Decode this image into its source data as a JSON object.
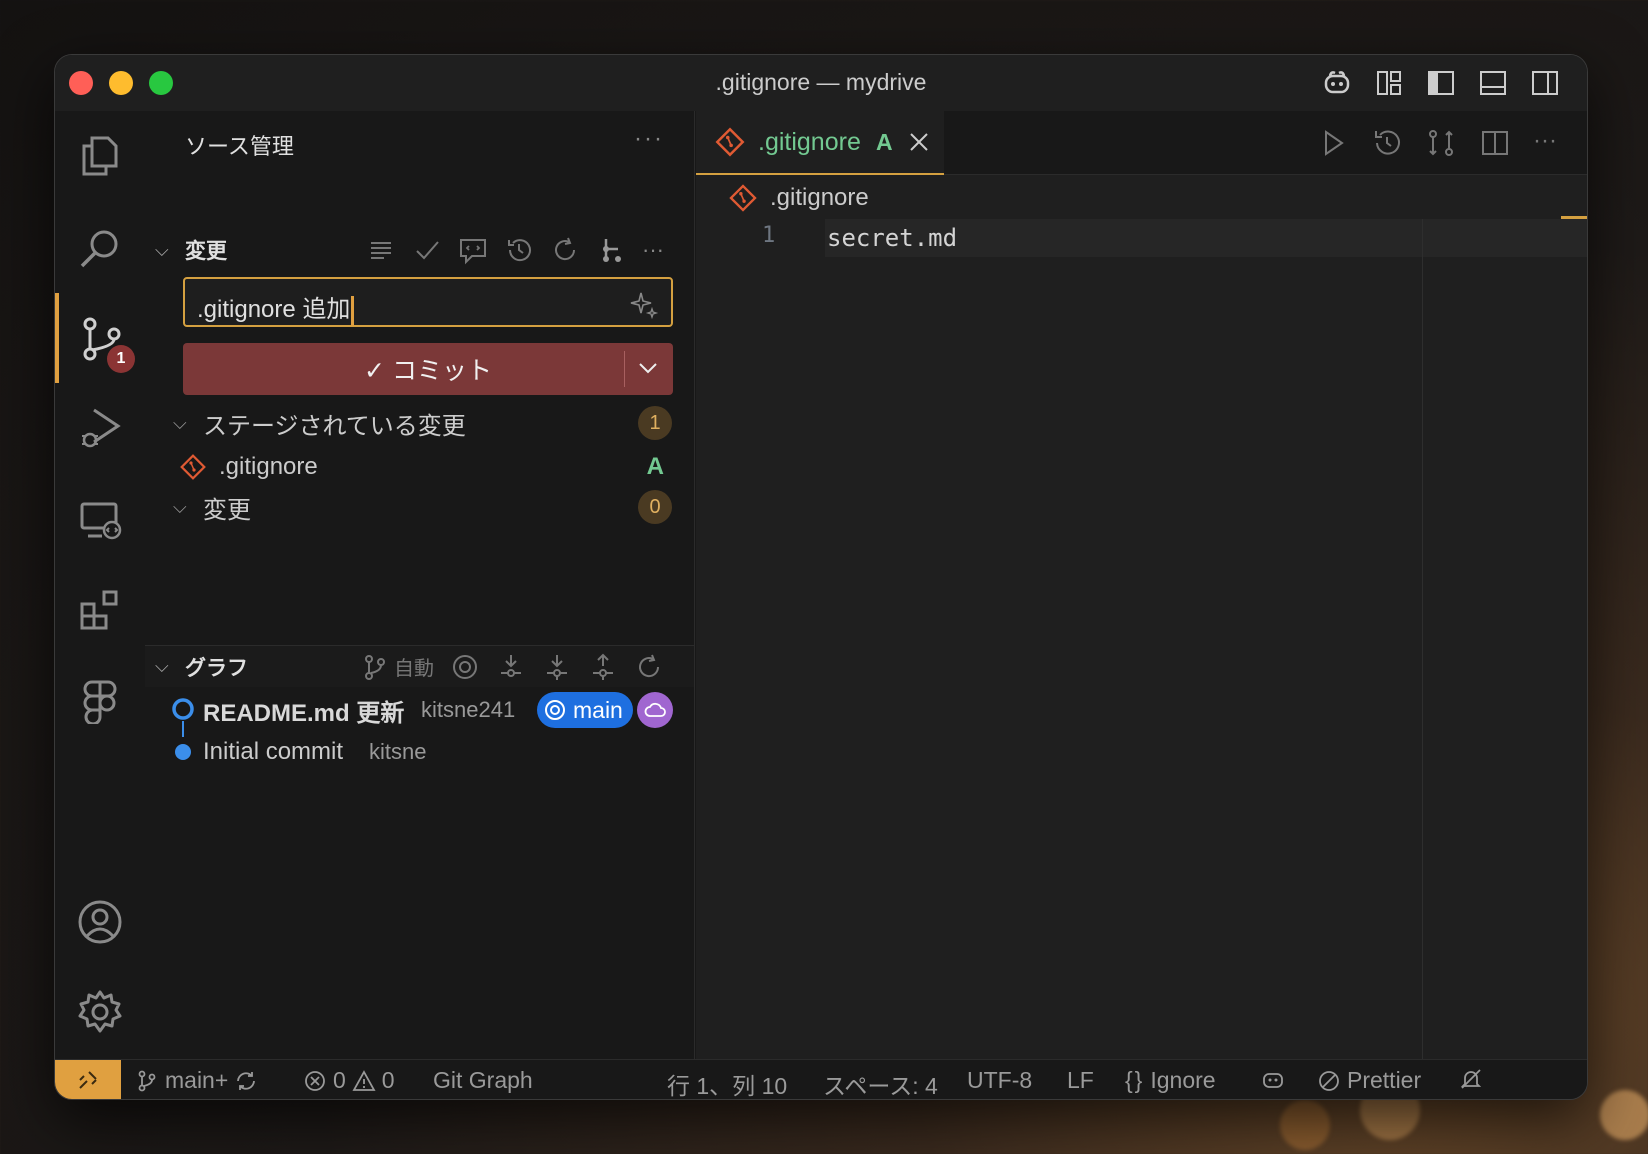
{
  "window": {
    "title": ".gitignore — mydrive"
  },
  "activity": {
    "scm_badge": "1"
  },
  "sidebar": {
    "title": "ソース管理",
    "changes_section": "変更",
    "commit_message": ".gitignore 追加",
    "commit_button": "✓ コミット",
    "staged_label": "ステージされている変更",
    "staged_count": "1",
    "staged_file": ".gitignore",
    "staged_file_status": "A",
    "changes_label": "変更",
    "changes_count": "0",
    "graph_section": "グラフ",
    "graph_auto": "自動",
    "commits": [
      {
        "message": "README.md 更新",
        "author": "kitsne241",
        "branch": "main"
      },
      {
        "message": "Initial commit",
        "author": "kitsne"
      }
    ]
  },
  "editor": {
    "tab_name": ".gitignore",
    "tab_status": "A",
    "breadcrumb": ".gitignore",
    "line_number": "1",
    "line_text": "secret.md"
  },
  "status": {
    "branch": "main+",
    "errors": "0",
    "warnings": "0",
    "git_graph": "Git Graph",
    "position": "行 1、列 10",
    "spaces": "スペース: 4",
    "encoding": "UTF-8",
    "eol": "LF",
    "language": "Ignore",
    "prettier": "Prettier"
  },
  "colors": {
    "accent": "#d4a040",
    "commit_button": "#7b3838",
    "branch_pill": "#1e6fe0",
    "added": "#73c991"
  }
}
